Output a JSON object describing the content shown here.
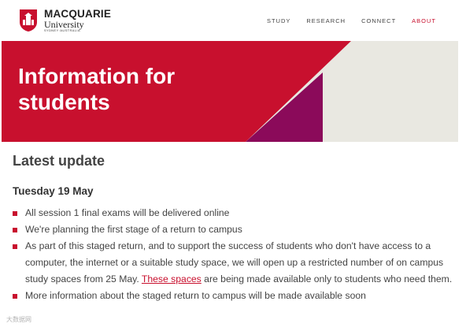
{
  "brand": {
    "line1": "MACQUARIE",
    "line2": "University",
    "line3": "SYDNEY·AUSTRALIA",
    "shield_color": "#c8102e"
  },
  "nav": {
    "items": [
      {
        "label": "STUDY"
      },
      {
        "label": "RESEARCH"
      },
      {
        "label": "CONNECT"
      },
      {
        "label": "ABOUT",
        "active": true
      }
    ]
  },
  "hero": {
    "title": "Information for students",
    "colors": {
      "red": "#c8102e",
      "purple": "#8b0a5a",
      "background": "#e9e8e1"
    }
  },
  "content": {
    "heading": "Latest update",
    "date": "Tuesday 19 May",
    "bullets": [
      {
        "text": "All session 1 final exams will be delivered online"
      },
      {
        "text": "We're planning the first stage of a return to campus"
      },
      {
        "text_before": "As part of this staged return, and to support the success of students who don't have access to a computer, the internet or a suitable study space, we will open up a restricted number of on campus study spaces from 25 May. ",
        "link": "These spaces",
        "text_after": " are being made available only to students who need them."
      },
      {
        "text": "More information about the staged return to campus will be made available soon"
      }
    ]
  },
  "watermark": "大数据网"
}
